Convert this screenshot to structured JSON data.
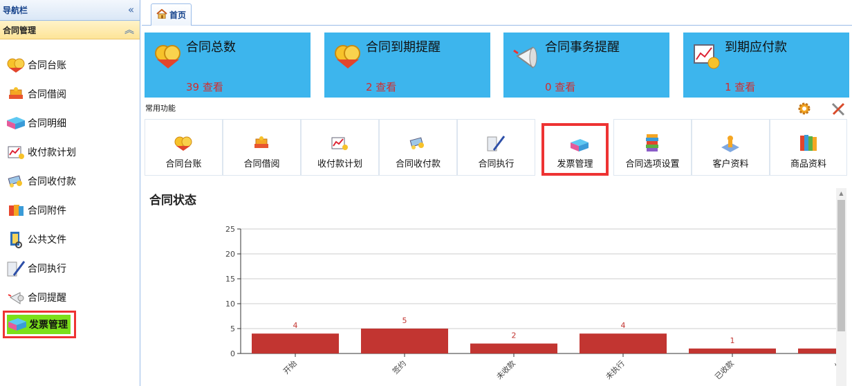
{
  "sidebar": {
    "title": "导航栏",
    "section": "合同管理",
    "items": [
      {
        "label": "合同台账",
        "icon": "ledger-icon"
      },
      {
        "label": "合同借阅",
        "icon": "borrow-icon"
      },
      {
        "label": "合同明细",
        "icon": "detail-icon"
      },
      {
        "label": "收付款计划",
        "icon": "payment-plan-icon"
      },
      {
        "label": "合同收付款",
        "icon": "payment-icon"
      },
      {
        "label": "合同附件",
        "icon": "attachment-icon"
      },
      {
        "label": "公共文件",
        "icon": "public-file-icon"
      },
      {
        "label": "合同执行",
        "icon": "execute-icon"
      },
      {
        "label": "合同提醒",
        "icon": "reminder-icon"
      },
      {
        "label": "发票管理",
        "icon": "invoice-icon",
        "active": true
      }
    ]
  },
  "tabs": [
    {
      "label": "首页",
      "icon": "home-icon"
    }
  ],
  "cards": [
    {
      "title": "合同总数",
      "count": "39 查看"
    },
    {
      "title": "合同到期提醒",
      "count": "2 查看"
    },
    {
      "title": "合同事务提醒",
      "count": "0 查看"
    },
    {
      "title": "到期应付款",
      "count": "1 查看"
    }
  ],
  "functions_label": "常用功能",
  "functions": [
    {
      "label": "合同台账"
    },
    {
      "label": "合同借阅"
    },
    {
      "label": "收付款计划"
    },
    {
      "label": "合同收付款"
    },
    {
      "label": "合同执行"
    },
    {
      "label": "发票管理",
      "highlight": true
    },
    {
      "label": "合同选项设置"
    },
    {
      "label": "客户资料"
    },
    {
      "label": "商品资料"
    }
  ],
  "chart_title": "合同状态",
  "chart_data": {
    "type": "bar",
    "title": "合同状态",
    "categories": [
      "开始",
      "签约",
      "未收款",
      "未执行",
      "已收款",
      "执"
    ],
    "values": [
      4,
      5,
      2,
      4,
      1,
      1
    ],
    "ylim": [
      0,
      25
    ],
    "yticks": [
      0,
      5,
      10,
      15,
      20,
      25
    ],
    "value_labels": [
      "4",
      "5",
      "2",
      "4",
      "1"
    ],
    "bar_color": "#c23531",
    "grid": true
  },
  "colors": {
    "card_bg": "#3db5ed",
    "card_count": "#d42b2b",
    "active_nav_bg": "#7be01a",
    "highlight_border": "#ee3333"
  }
}
